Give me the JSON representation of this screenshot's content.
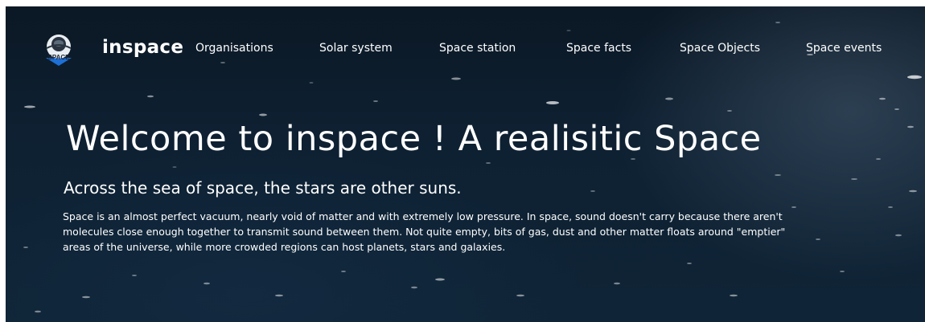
{
  "brand": {
    "name": "inspace",
    "logo_text": "SPACE"
  },
  "nav": {
    "items": [
      {
        "label": "Organisations"
      },
      {
        "label": "Solar system"
      },
      {
        "label": "Space station"
      },
      {
        "label": "Space facts"
      },
      {
        "label": "Space Objects"
      },
      {
        "label": "Space events"
      }
    ]
  },
  "hero": {
    "title": "Welcome to inspace ! A realisitic Space",
    "subtitle": "Across the sea of space, the stars are other suns.",
    "description": "Space is an almost perfect vacuum, nearly void of matter and with extremely low pressure. In space, sound doesn't carry because there aren't molecules close enough together to transmit sound between them. Not quite empty, bits of gas, dust and other matter floats around \"emptier\" areas of the universe, while more crowded regions can host planets, stars and galaxies."
  },
  "colors": {
    "background": "#0e2133",
    "text": "#ffffff"
  }
}
